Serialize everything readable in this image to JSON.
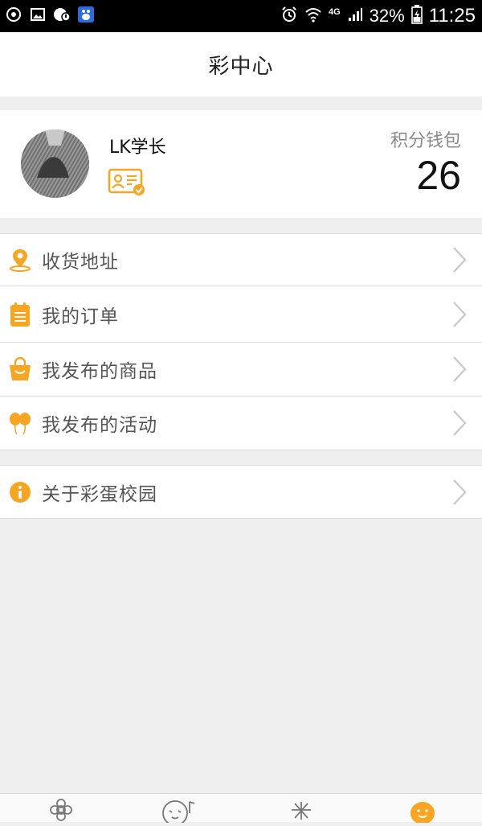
{
  "status_bar": {
    "network": "4G",
    "battery": "32%",
    "time": "11:25"
  },
  "header": {
    "title": "彩中心"
  },
  "profile": {
    "username": "LK学长",
    "wallet_label": "积分钱包",
    "wallet_value": "26"
  },
  "menu": {
    "items": [
      {
        "label": "收货地址",
        "icon": "location-pin-icon"
      },
      {
        "label": "我的订单",
        "icon": "clipboard-icon"
      },
      {
        "label": "我发布的商品",
        "icon": "shopping-bag-icon"
      },
      {
        "label": "我发布的活动",
        "icon": "balloons-icon"
      }
    ],
    "about": {
      "label": "关于彩蛋校园",
      "icon": "info-icon"
    }
  },
  "tabs": [
    {
      "icon": "flower-icon",
      "active": false
    },
    {
      "icon": "chat-face-icon",
      "active": false
    },
    {
      "icon": "sparkle-icon",
      "active": false
    },
    {
      "icon": "egg-face-icon",
      "active": true
    }
  ],
  "colors": {
    "accent": "#f6a623",
    "background": "#efefef",
    "statusbar": "#000000"
  }
}
